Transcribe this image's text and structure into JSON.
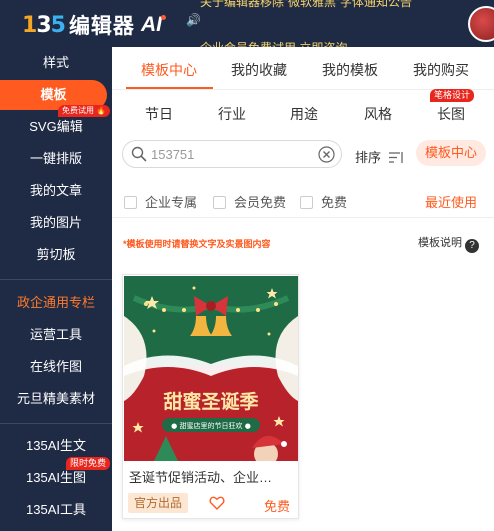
{
  "header": {
    "logo_number": [
      "1",
      "3",
      "5"
    ],
    "logo_text": "编辑器",
    "logo_ai": "AI",
    "marquee_top": "关于编辑器移除“微软雅黑”字体通知公告",
    "marquee_bottom": "企业会员免费试用 立即咨询"
  },
  "sidebar": {
    "items": [
      {
        "label": "样式"
      },
      {
        "label": "模板"
      },
      {
        "label": "SVG编辑"
      },
      {
        "label": "一键排版"
      },
      {
        "label": "我的文章"
      },
      {
        "label": "我的图片"
      },
      {
        "label": "剪切板"
      },
      {
        "label": "政企通用专栏"
      },
      {
        "label": "运营工具"
      },
      {
        "label": "在线作图"
      },
      {
        "label": "元旦精美素材"
      },
      {
        "label": "135AI生文"
      },
      {
        "label": "135AI生图"
      },
      {
        "label": "135AI工具"
      }
    ],
    "badge_trial": "免费试用 🔥",
    "badge_free": "限时免费"
  },
  "main": {
    "tabs": [
      {
        "label": "模板中心"
      },
      {
        "label": "我的收藏"
      },
      {
        "label": "我的模板"
      },
      {
        "label": "我的购买"
      }
    ],
    "subtabs": [
      {
        "label": "节日"
      },
      {
        "label": "行业"
      },
      {
        "label": "用途"
      },
      {
        "label": "风格"
      },
      {
        "label": "长图"
      }
    ],
    "badge_hot": "笔格设计",
    "search": {
      "value": "153751"
    },
    "sort_label": "排序",
    "center_button": "模板中心",
    "filters": [
      {
        "label": "企业专属"
      },
      {
        "label": "会员免费"
      },
      {
        "label": "免费"
      }
    ],
    "recent": "最近使用",
    "notice": "*模板使用时请替换文字及实景图内容",
    "help": "模板说明",
    "help_icon": "?"
  },
  "card": {
    "thumb_title": "甜蜜圣诞季",
    "thumb_subtitle": "● 甜蜜店里的节日狂欢 ●",
    "title": "圣诞节促销活动、企业…",
    "tag": "官方出品",
    "price": "免费"
  },
  "colors": {
    "accent": "#ff5a1f",
    "sidebar_bg": "#1f2a44",
    "badge_red": "#e8261e",
    "thumb_green": "#1e6b45",
    "thumb_red": "#b8222b"
  }
}
